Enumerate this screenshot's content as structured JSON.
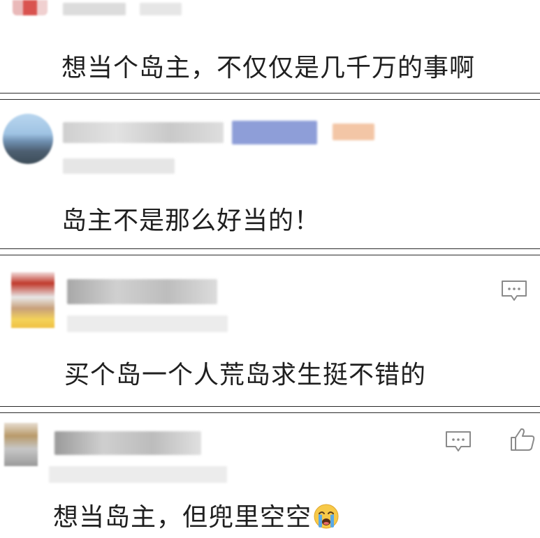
{
  "comments": [
    {
      "text": "想当个岛主，不仅仅是几千万的事啊"
    },
    {
      "text": "岛主不是那么好当的！"
    },
    {
      "text": "买个岛一个人荒岛求生挺不错的"
    },
    {
      "text": "想当岛主，但兜里空空"
    }
  ],
  "icons": {
    "reply": "comment-icon",
    "like": "thumbs-up-icon",
    "emoji": "loudly-crying-face-emoji"
  },
  "colors": {
    "separator": "#2a2a2a",
    "icon_stroke": "#8a8a8a",
    "text": "#1f1f1f"
  }
}
